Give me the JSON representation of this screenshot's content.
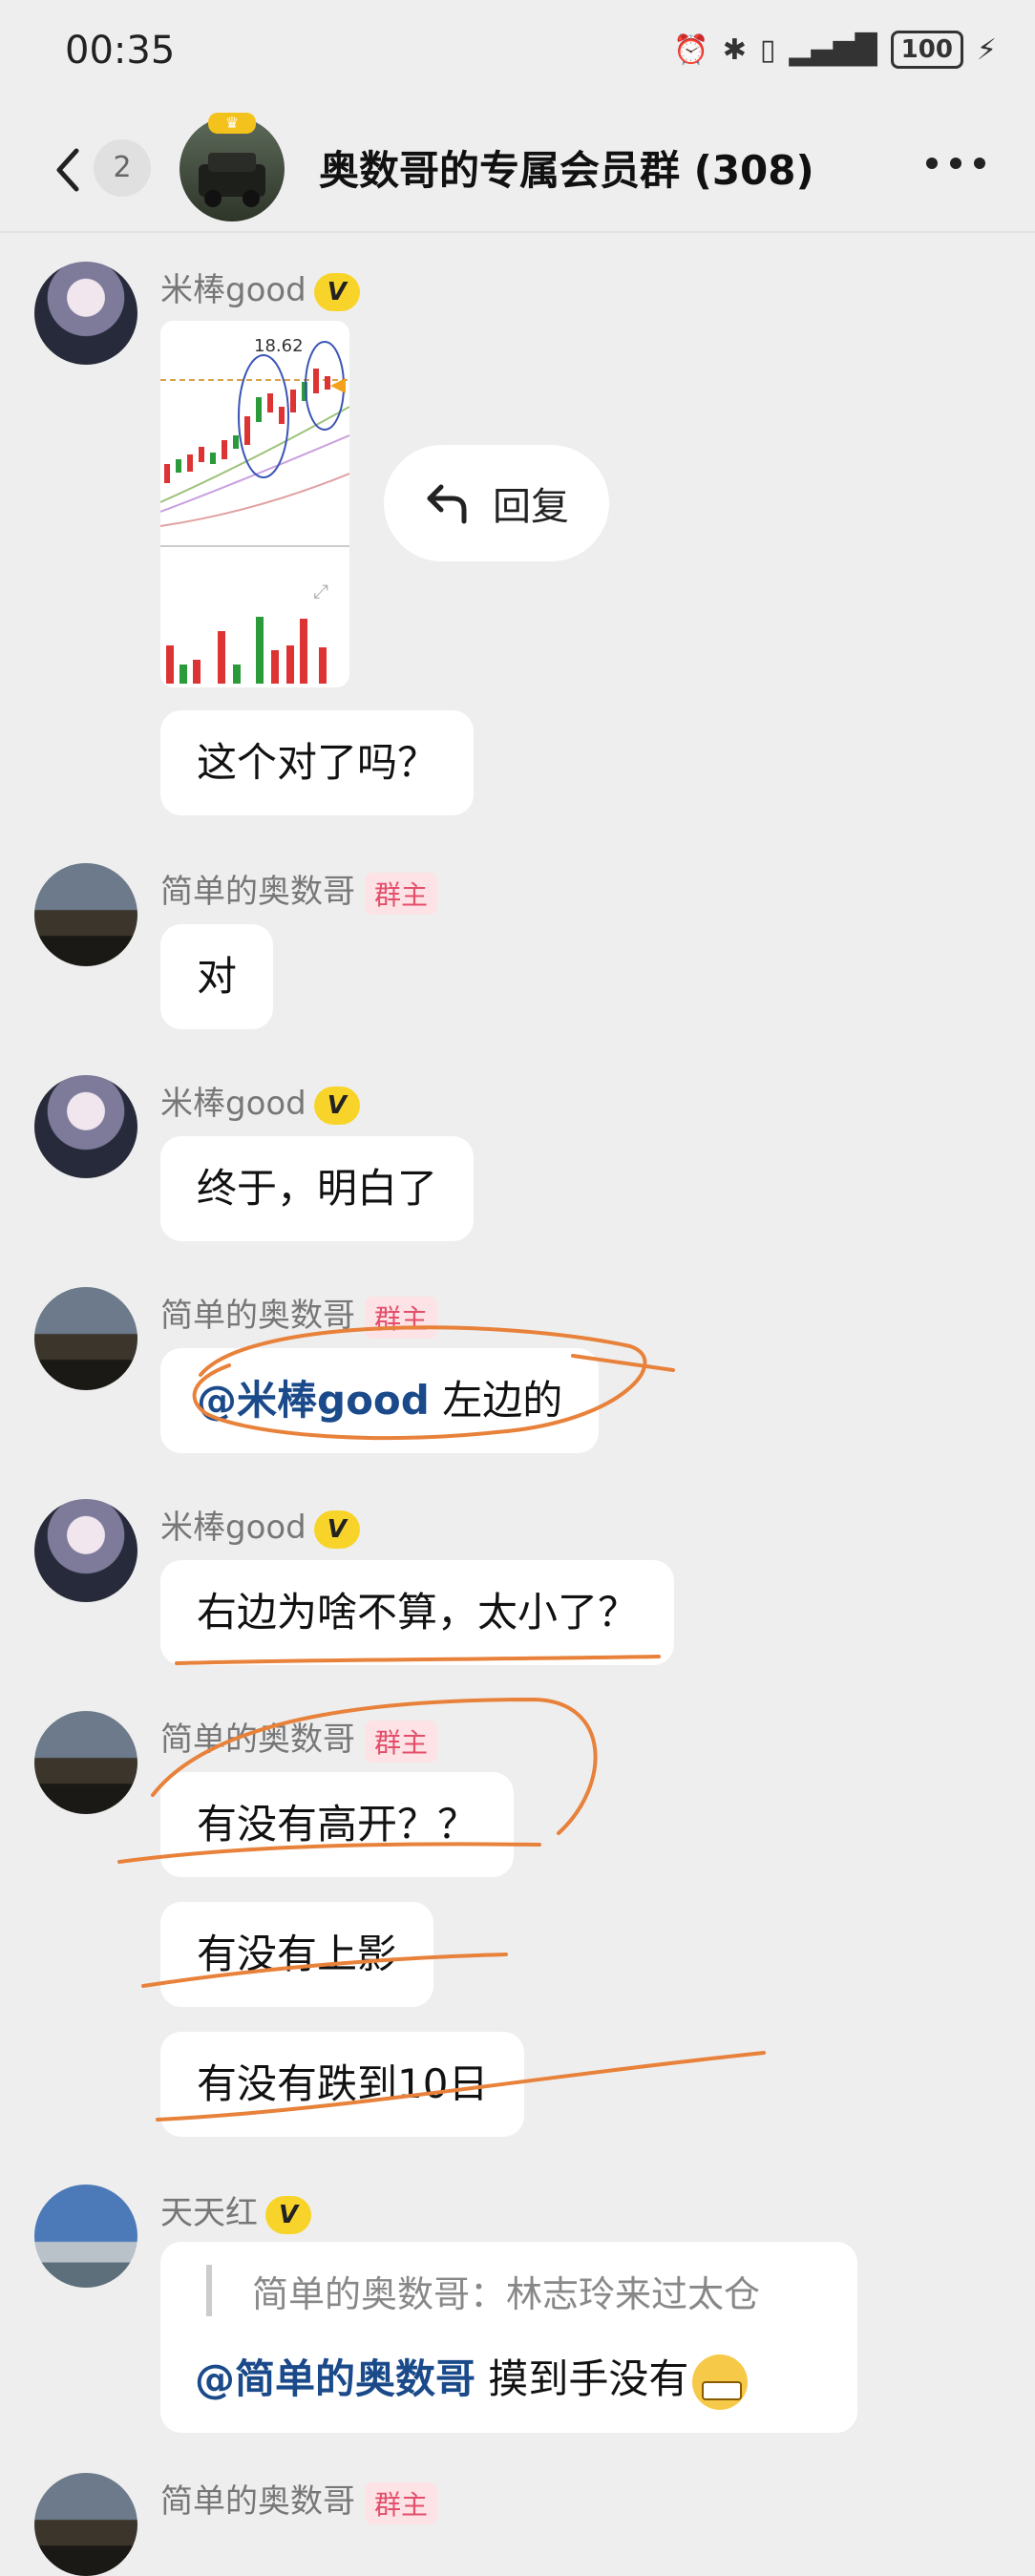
{
  "status_bar": {
    "time": "00:35",
    "battery": "100"
  },
  "header": {
    "unread_count": "2",
    "title": "奥数哥的专属会员群 (308)"
  },
  "reply_action": {
    "label": "回复"
  },
  "badges": {
    "v": "V",
    "owner": "群主"
  },
  "messages": [
    {
      "sender": "米棒good",
      "badge": "V",
      "text": "这个对了吗？"
    },
    {
      "sender": "简单的奥数哥",
      "badge": "群主",
      "text": "对"
    },
    {
      "sender": "米棒good",
      "badge": "V",
      "text": "终于，明白了"
    },
    {
      "sender": "简单的奥数哥",
      "badge": "群主",
      "mention": "@米棒good",
      "text": "左边的"
    },
    {
      "sender": "米棒good",
      "badge": "V",
      "text": "右边为啥不算，太小了？"
    },
    {
      "sender": "简单的奥数哥",
      "badge": "群主",
      "texts": [
        "有没有高开？？",
        "有没有上影",
        "有没有跌到10日"
      ]
    },
    {
      "sender": "天天红",
      "badge": "V",
      "quote": "简单的奥数哥：林志玲来过太仓",
      "mention": "@简单的奥数哥",
      "text": "摸到手没有"
    },
    {
      "sender": "简单的奥数哥",
      "badge": "群主"
    }
  ],
  "chart_thumb": {
    "price_label": "18.62"
  },
  "colors": {
    "annotation": "#e8813a",
    "mention": "#1b4a8a",
    "owner_badge": "#e34e6a",
    "v_badge": "#f8d42a",
    "background": "#eeeeee"
  }
}
